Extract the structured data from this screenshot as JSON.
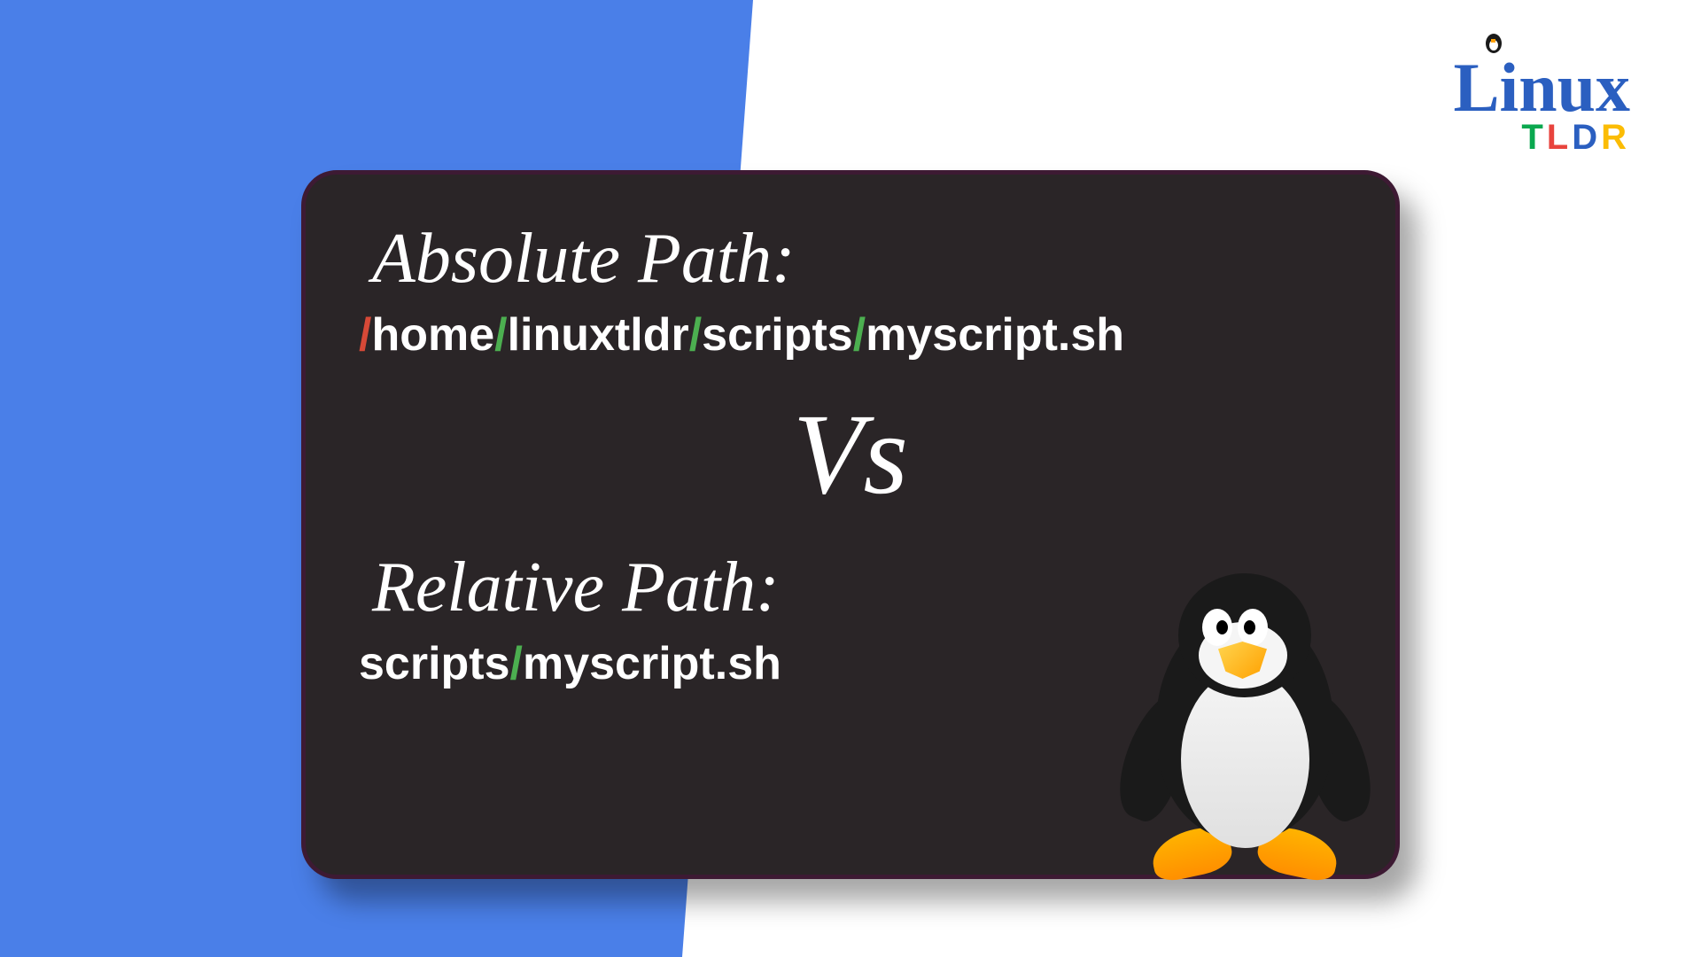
{
  "logo": {
    "main": "Linux",
    "sub_t": "T",
    "sub_l": "L",
    "sub_d": "D",
    "sub_r": "R"
  },
  "card": {
    "heading1": "Absolute Path:",
    "path1_parts": {
      "s1": "/",
      "p1": "home",
      "s2": "/",
      "p2": "linuxtldr",
      "s3": "/",
      "p3": "scripts",
      "s4": "/",
      "p4": "myscript.sh"
    },
    "vs": "Vs",
    "heading2": "Relative Path:",
    "path2_parts": {
      "p1": "scripts",
      "s1": "/",
      "p2": "myscript.sh"
    }
  }
}
